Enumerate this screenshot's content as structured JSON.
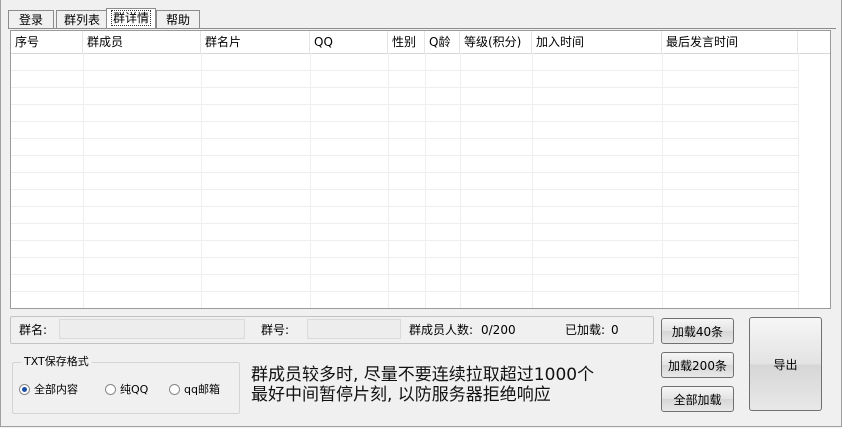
{
  "tabs": [
    "登录",
    "群列表",
    "群详情",
    "帮助"
  ],
  "table": {
    "columns": [
      "序号",
      "群成员",
      "群名片",
      "QQ",
      "性别",
      "Q龄",
      "等级(积分)",
      "加入时间",
      "最后发言时间"
    ]
  },
  "info": {
    "group_name_label": "群名:",
    "group_name_value": "",
    "group_id_label": "群号:",
    "group_id_value": "",
    "member_count_label": "群成员人数:",
    "member_count_value": "0/200",
    "loaded_label": "已加载:",
    "loaded_value": "0"
  },
  "txt_format": {
    "title": "TXT保存格式",
    "options": [
      "全部内容",
      "纯QQ",
      "qq邮箱"
    ],
    "selected": "全部内容"
  },
  "notice": {
    "line1": "群成员较多时, 尽量不要连续拉取超过1000个",
    "line2": "最好中间暂停片刻, 以防服务器拒绝响应"
  },
  "buttons": {
    "load40": "加载40条",
    "load200": "加载200条",
    "load_all": "全部加载",
    "export": "导出"
  }
}
